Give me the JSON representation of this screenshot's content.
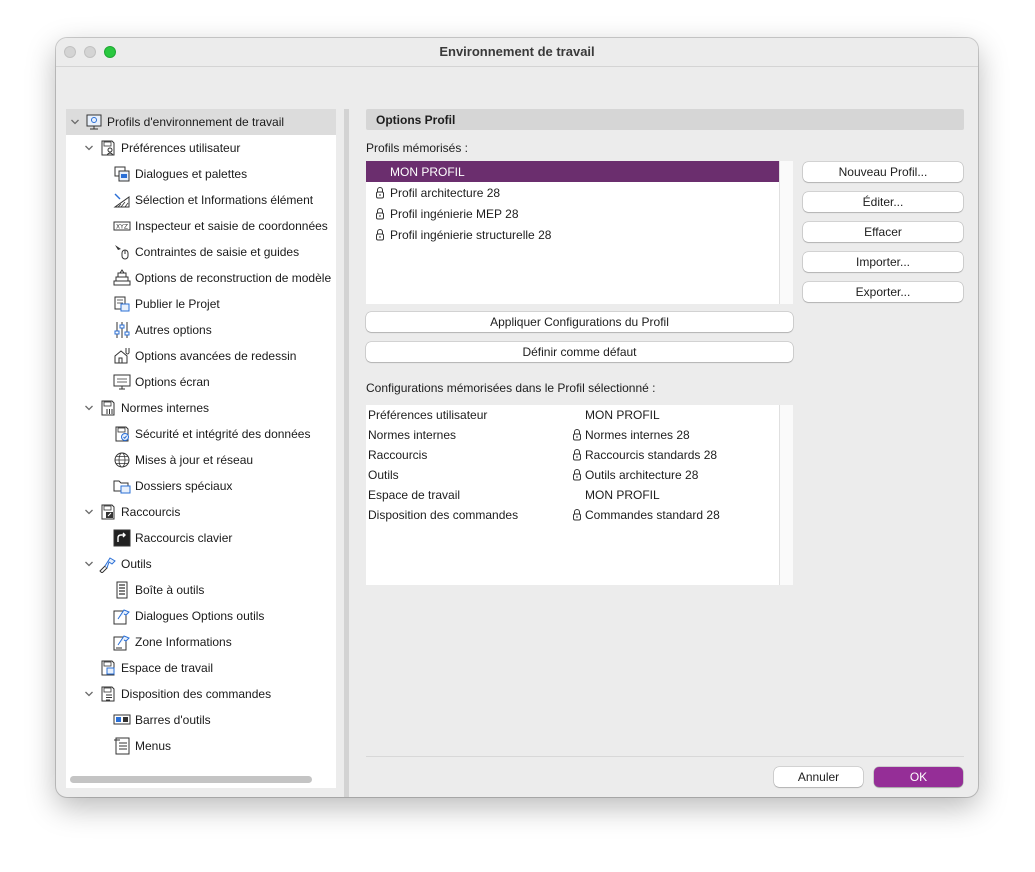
{
  "window": {
    "title": "Environnement de travail"
  },
  "tree": {
    "items": [
      {
        "label": "Profils d'environnement de travail",
        "icon": "workspace-profiles-icon"
      },
      {
        "label": "Préférences utilisateur",
        "icon": "user-preferences-icon"
      },
      {
        "label": "Dialogues et palettes",
        "icon": "dialogs-palettes-icon"
      },
      {
        "label": "Sélection et Informations élément",
        "icon": "selection-info-icon"
      },
      {
        "label": "Inspecteur et saisie de coordonnées",
        "icon": "xyz-coordinates-icon"
      },
      {
        "label": "Contraintes de saisie et guides",
        "icon": "input-constraints-icon"
      },
      {
        "label": "Options de reconstruction de modèle",
        "icon": "model-rebuild-icon"
      },
      {
        "label": "Publier le Projet",
        "icon": "publish-project-icon"
      },
      {
        "label": "Autres options",
        "icon": "sliders-icon"
      },
      {
        "label": "Options avancées de redessin",
        "icon": "advanced-redraw-icon"
      },
      {
        "label": "Options écran",
        "icon": "screen-options-icon"
      },
      {
        "label": "Normes internes",
        "icon": "internal-standards-icon"
      },
      {
        "label": "Sécurité et intégrité des données",
        "icon": "data-safety-icon"
      },
      {
        "label": "Mises à jour et réseau",
        "icon": "globe-icon"
      },
      {
        "label": "Dossiers spéciaux",
        "icon": "special-folders-icon"
      },
      {
        "label": "Raccourcis",
        "icon": "shortcuts-icon"
      },
      {
        "label": "Raccourcis clavier",
        "icon": "keyboard-shortcut-icon"
      },
      {
        "label": "Outils",
        "icon": "tools-icon"
      },
      {
        "label": "Boîte à outils",
        "icon": "toolbox-icon"
      },
      {
        "label": "Dialogues Options outils",
        "icon": "tool-settings-icon"
      },
      {
        "label": "Zone Informations",
        "icon": "info-box-icon"
      },
      {
        "label": "Espace de travail",
        "icon": "work-environment-icon"
      },
      {
        "label": "Disposition des commandes",
        "icon": "command-layout-icon"
      },
      {
        "label": "Barres d'outils",
        "icon": "toolbar-icon"
      },
      {
        "label": "Menus",
        "icon": "menus-icon"
      }
    ]
  },
  "main": {
    "section_title": "Options Profil",
    "stored_profiles_label": "Profils mémorisés :",
    "profiles": [
      {
        "label": "MON PROFIL",
        "locked": false,
        "selected": true
      },
      {
        "label": "Profil architecture 28",
        "locked": true,
        "selected": false
      },
      {
        "label": "Profil ingénierie MEP 28",
        "locked": true,
        "selected": false
      },
      {
        "label": "Profil ingénierie structurelle 28",
        "locked": true,
        "selected": false
      }
    ],
    "buttons": {
      "new_profile": "Nouveau Profil...",
      "edit": "Éditer...",
      "delete": "Effacer",
      "import": "Importer...",
      "export": "Exporter...",
      "apply": "Appliquer Configurations du Profil",
      "set_default": "Définir comme défaut"
    },
    "configs_label": "Configurations mémorisées dans le Profil sélectionné :",
    "configs": [
      {
        "key": "Préférences utilisateur",
        "value": "MON PROFIL",
        "locked": false
      },
      {
        "key": "Normes internes",
        "value": "Normes internes 28",
        "locked": true
      },
      {
        "key": "Raccourcis",
        "value": "Raccourcis standards 28",
        "locked": true
      },
      {
        "key": "Outils",
        "value": "Outils architecture 28",
        "locked": true
      },
      {
        "key": "Espace de travail",
        "value": "MON PROFIL",
        "locked": false
      },
      {
        "key": "Disposition des commandes",
        "value": "Commandes standard 28",
        "locked": true
      }
    ]
  },
  "footer": {
    "cancel": "Annuler",
    "ok": "OK"
  },
  "colors": {
    "selection": "#6b2e6e",
    "primary_button": "#952e97",
    "zoom_light": "#2ac840"
  }
}
